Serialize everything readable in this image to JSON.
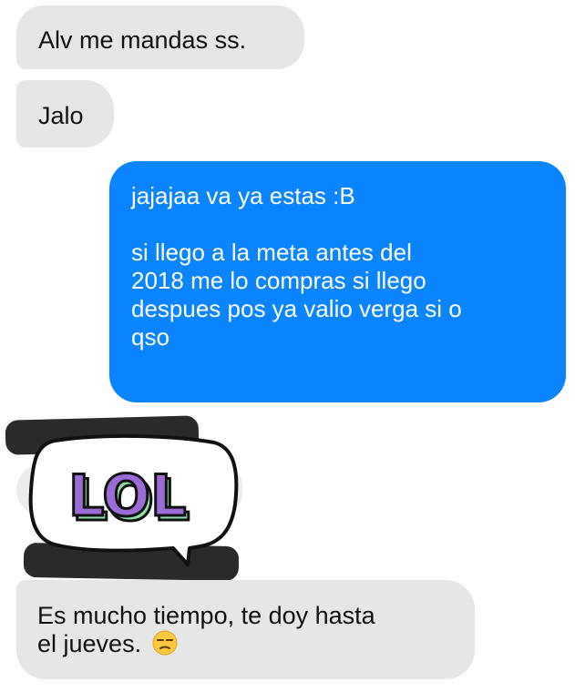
{
  "messages": [
    {
      "direction": "incoming",
      "text": "Alv me mandas ss."
    },
    {
      "direction": "incoming",
      "text": "Jalo"
    },
    {
      "direction": "outgoing",
      "line1": "jajajaa va ya estas :B",
      "line2": "si llego a la meta antes del",
      "line3": "2018 me lo compras si llego",
      "line4": "despues pos ya valio verga si o",
      "line5": "qso"
    },
    {
      "direction": "incoming",
      "type": "sticker",
      "sticker_text": "LOL"
    },
    {
      "direction": "incoming",
      "line1": "Es mucho tiempo, te doy hasta",
      "line2": "el jueves.",
      "emoji": "unamused-face-icon"
    }
  ],
  "colors": {
    "incoming_bubble": "#e6e6e6",
    "outgoing_bubble": "#0a84ff",
    "sticker_fill": "#9b6bd6",
    "sticker_side": "#8fe0a8",
    "redaction": "#2a2a2a"
  }
}
